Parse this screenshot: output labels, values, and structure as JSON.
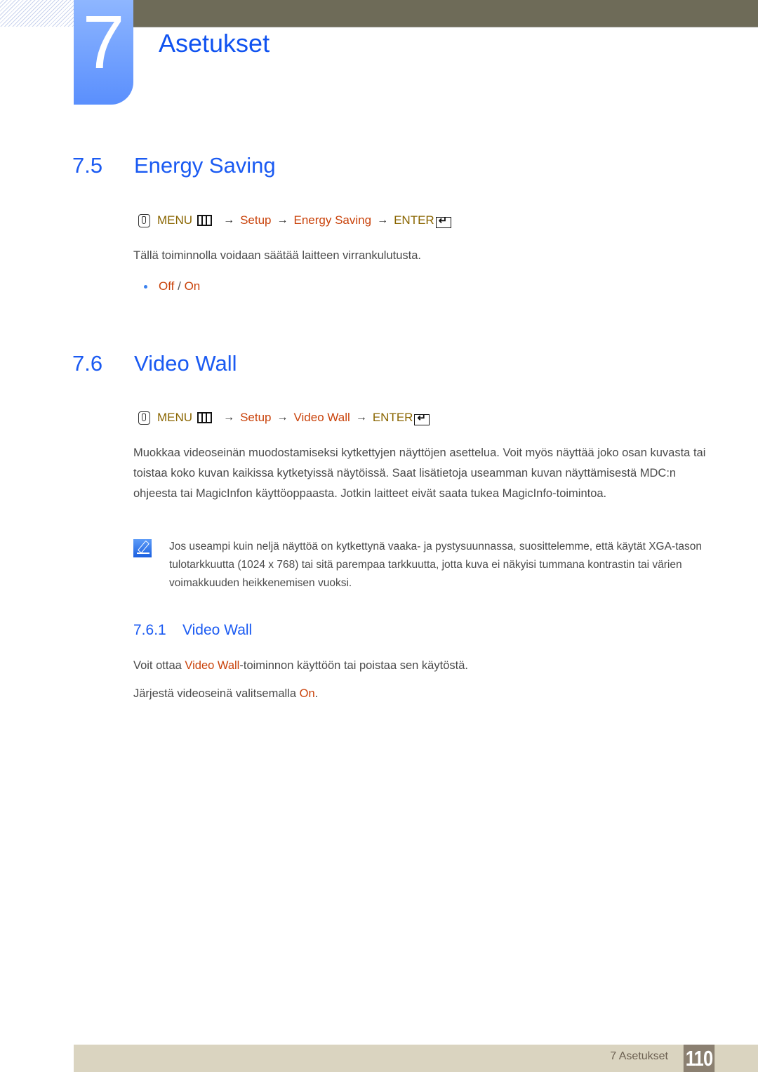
{
  "chapter": {
    "number": "7",
    "title": "Asetukset"
  },
  "sections": [
    {
      "number": "7.5",
      "title": "Energy Saving",
      "menu_path": {
        "menu_label": "MENU",
        "arrow": "→",
        "steps": [
          "Setup",
          "Energy Saving"
        ],
        "enter_label": "ENTER"
      },
      "description": "Tällä toiminnolla voidaan säätää laitteen virrankulutusta.",
      "options": {
        "off": "Off",
        "separator": "/",
        "on": "On"
      }
    },
    {
      "number": "7.6",
      "title": "Video Wall",
      "menu_path": {
        "menu_label": "MENU",
        "arrow": "→",
        "steps": [
          "Setup",
          "Video Wall"
        ],
        "enter_label": "ENTER"
      },
      "description": "Muokkaa videoseinän muodostamiseksi kytkettyjen näyttöjen asettelua. Voit myös näyttää joko osan kuvasta tai toistaa koko kuvan kaikissa kytketyissä näytöissä. Saat lisätietoja useamman kuvan näyttämisestä MDC:n ohjeesta tai MagicInfon käyttöoppaasta. Jotkin laitteet eivät saata tukea MagicInfo-toimintoa.",
      "note": "Jos useampi kuin neljä näyttöä on kytkettynä vaaka- ja pystysuunnassa, suosittelemme, että käytät XGA-tason tulotarkkuutta (1024 x 768) tai sitä parempaa tarkkuutta, jotta kuva ei näkyisi tummana kontrastin tai värien voimakkuuden heikkenemisen vuoksi.",
      "subsection": {
        "number": "7.6.1",
        "title": "Video Wall",
        "para1": {
          "before": "Voit ottaa ",
          "highlight": "Video Wall",
          "after": "-toiminnon käyttöön tai poistaa sen käytöstä."
        },
        "para2": {
          "before": "Järjestä videoseinä valitsemalla ",
          "highlight": "On",
          "after": "."
        }
      }
    }
  ],
  "footer": {
    "label": "7 Asetukset",
    "page_number": "110"
  },
  "colors": {
    "heading_blue": "#1a5af2",
    "menu_gold": "#8a6500",
    "option_orange": "#c9420a",
    "topbar": "#6e6b58",
    "footer_bg": "#dad4c0",
    "page_badge": "#8b8071"
  }
}
